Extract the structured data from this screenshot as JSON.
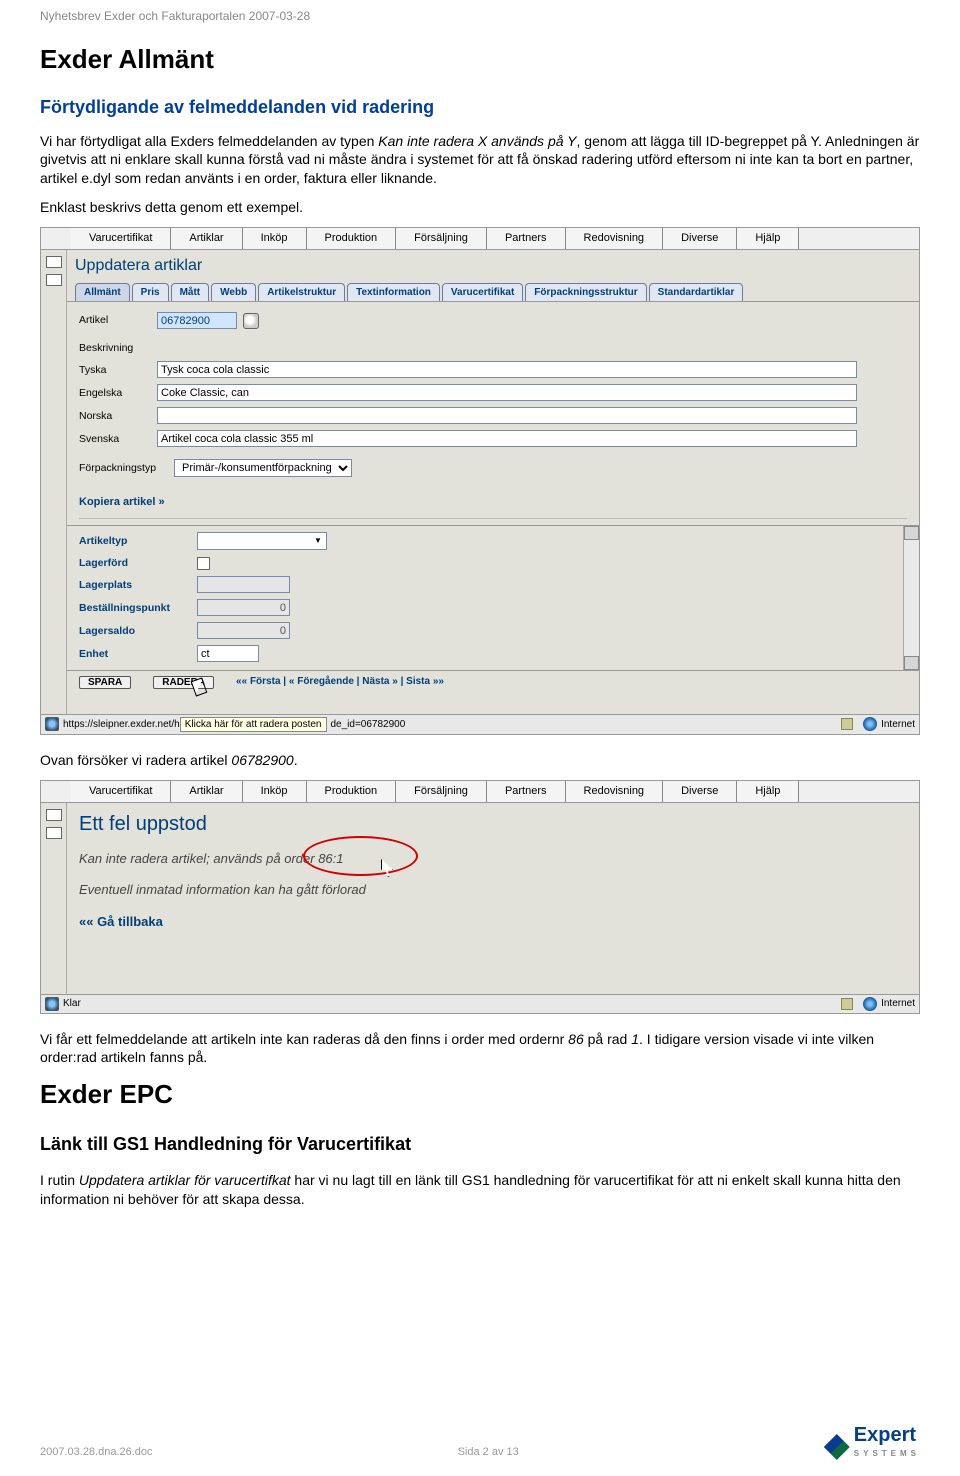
{
  "header_note": "Nyhetsbrev Exder och Fakturaportalen 2007-03-28",
  "h1": "Exder Allmänt",
  "section1_title": "Förtydligande av felmeddelanden vid radering",
  "para1a": "Vi har förtydligat alla Exders felmeddelanden av typen ",
  "para1b": "Kan inte radera X används på Y",
  "para1c": ", genom att lägga till ID-begreppet på Y. Anledningen är givetvis att ni enklare skall kunna förstå vad ni måste ändra i systemet för att få önskad radering utförd eftersom ni inte kan ta bort en partner, artikel e.dyl som redan använts i en order, faktura eller liknande.",
  "para2": "Enklast beskrivs detta genom ett exempel.",
  "para3a": "Ovan försöker vi radera artikel ",
  "para3b": "06782900",
  "para3c": ".",
  "para4a": "Vi får ett felmeddelande att artikeln inte kan raderas då den finns i order med ordernr ",
  "para4b": "86",
  "para4c": " på rad ",
  "para4d": "1",
  "para4e": ". I tidigare version visade vi inte vilken order:rad artikeln fanns på.",
  "h2_epc": "Exder EPC",
  "section2_title": "Länk till GS1 Handledning för Varucertifikat",
  "para5a": "I rutin ",
  "para5b": "Uppdatera artiklar för varucertifkat",
  "para5c": " har vi nu lagt till en länk till GS1 handledning för varucertifikat för att ni enkelt skall kunna hitta den information ni behöver för att skapa dessa.",
  "footer_left": "2007.03.28.dna.26.doc",
  "footer_center": "Sida 2 av 13",
  "logo_text": "Expert",
  "logo_sub": "SYSTEMS",
  "shot1": {
    "menu": [
      "Varucertifikat",
      "Artiklar",
      "Inköp",
      "Produktion",
      "Försäljning",
      "Partners",
      "Redovisning",
      "Diverse",
      "Hjälp"
    ],
    "title": "Uppdatera artiklar",
    "subtabs": [
      "Allmänt",
      "Pris",
      "Mått",
      "Webb",
      "Artikelstruktur",
      "Textinformation",
      "Varucertifikat",
      "Förpackningsstruktur",
      "Standardartiklar"
    ],
    "lbl_artikel": "Artikel",
    "val_artikel": "06782900",
    "lbl_beskrivning": "Beskrivning",
    "lbl_tyska": "Tyska",
    "val_tyska": "Tysk coca cola classic",
    "lbl_engelska": "Engelska",
    "val_engelska": "Coke Classic, can",
    "lbl_norska": "Norska",
    "val_norska": "",
    "lbl_svenska": "Svenska",
    "val_svenska": "Artikel coca cola classic 355 ml",
    "lbl_forpackningstyp": "Förpackningstyp",
    "val_forpackningstyp": "Primär-/konsumentförpackning",
    "link_copy": "Kopiera artikel »",
    "lbl_artikeltyp": "Artikeltyp",
    "lbl_lagerford": "Lagerförd",
    "lbl_lagerplats": "Lagerplats",
    "lbl_bestallningspunkt": "Beställningspunkt",
    "val_bestallningspunkt": "0",
    "lbl_lagersaldo": "Lagersaldo",
    "val_lagersaldo": "0",
    "lbl_enhet": "Enhet",
    "val_enhet": "ct",
    "btn_spara": "SPARA",
    "btn_radera": "RADERA",
    "nav": "«« Första  |  « Föregående  |  Nästa »  |  Sista »»",
    "status_url": "https://sleipner.exder.net/h",
    "status_hint": "Klicka här för att radera posten",
    "status_url2": "de_id=06782900",
    "status_zone": "Internet"
  },
  "shot2": {
    "menu": [
      "Varucertifikat",
      "Artiklar",
      "Inköp",
      "Produktion",
      "Försäljning",
      "Partners",
      "Redovisning",
      "Diverse",
      "Hjälp"
    ],
    "title": "Ett fel uppstod",
    "msg1": "Kan inte radera artikel; används på order 86:1",
    "msg2": "Eventuell inmatad information kan ha gått förlorad",
    "back": "«« Gå tillbaka",
    "status_klar": "Klar",
    "status_zone": "Internet"
  }
}
